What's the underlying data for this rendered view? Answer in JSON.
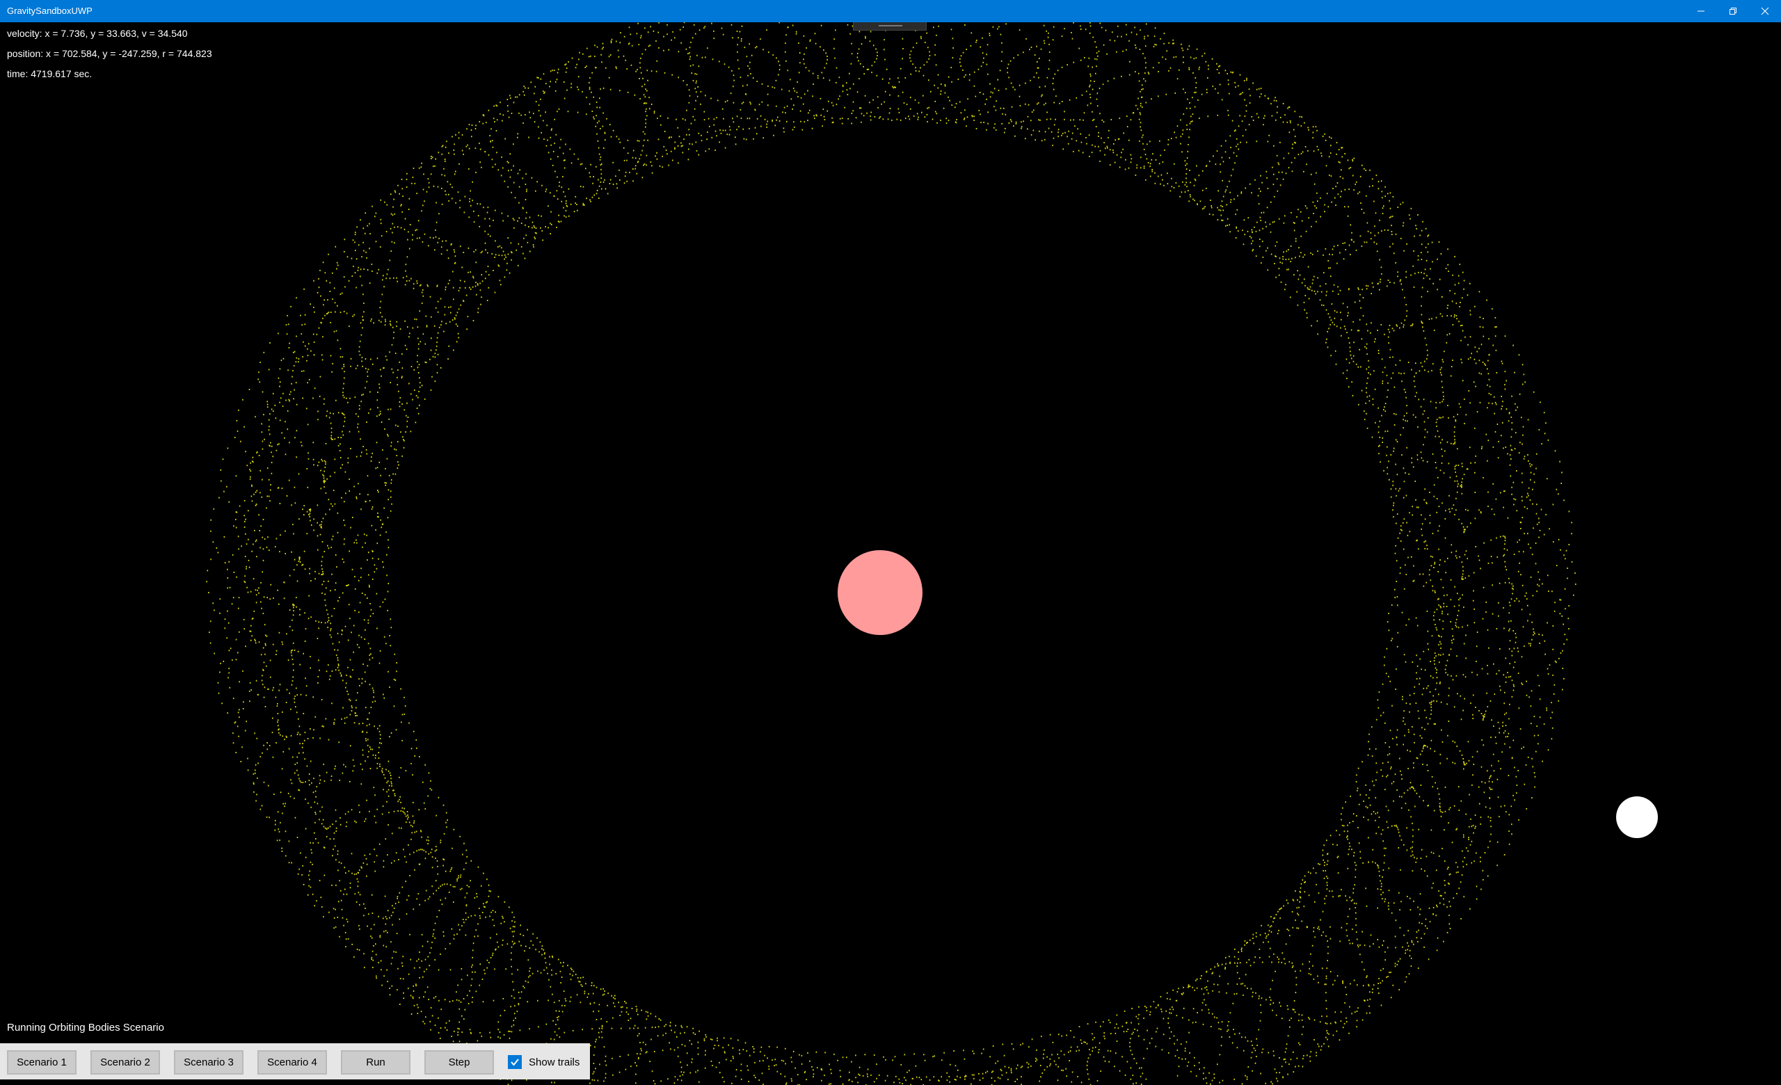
{
  "window": {
    "title": "GravitySandboxUWP"
  },
  "hud": {
    "velocity": "velocity: x = 7.736, y = 33.663, v = 34.540",
    "position": "position: x = 702.584, y = -247.259, r = 744.823",
    "time": "time: 4719.617 sec."
  },
  "status": "Running Orbiting Bodies Scenario",
  "toolbar": {
    "scenario1": "Scenario 1",
    "scenario2": "Scenario 2",
    "scenario3": "Scenario 3",
    "scenario4": "Scenario 4",
    "run": "Run",
    "step": "Step",
    "show_trails": "Show trails",
    "show_trails_checked": true
  },
  "colors": {
    "central_body": "#ff9b9b",
    "orbiting_body": "#ffffff",
    "trail": "#d8d80a",
    "titlebar": "#0078d7",
    "background": "#000000"
  }
}
